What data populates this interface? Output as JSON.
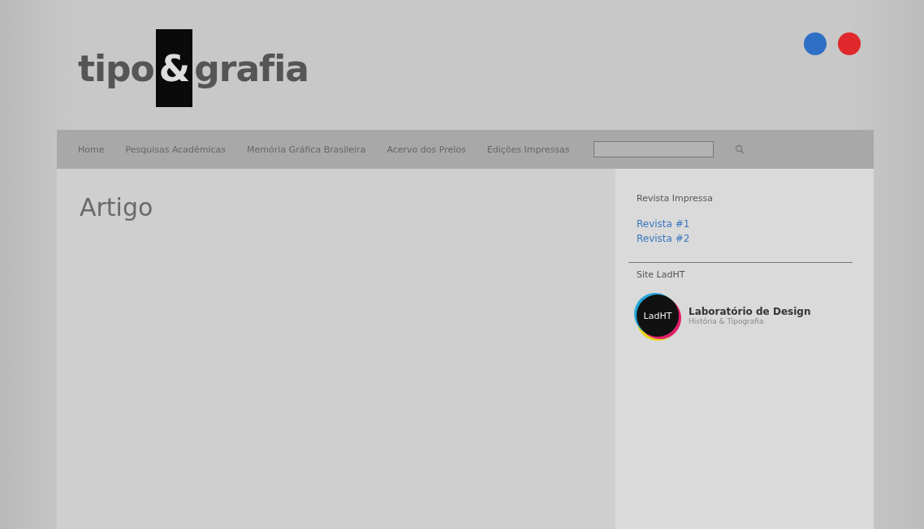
{
  "logo": {
    "before": "tipo",
    "mark": "&",
    "after": "grafia"
  },
  "social": [
    {
      "color": "#2d6fc4"
    },
    {
      "color": "#e0272b"
    }
  ],
  "nav": [
    {
      "label": "Home"
    },
    {
      "label": "Pesquisas Acadêmicas"
    },
    {
      "label": "Memória Gráfica Brasileira"
    },
    {
      "label": "Acervo dos Prelos"
    },
    {
      "label": "Edições Impressas"
    }
  ],
  "main": {
    "title": "Artigo"
  },
  "sidebar": {
    "sections": [
      {
        "title": "Revista Impressa",
        "links": [
          "Revista #1",
          "Revista #2"
        ]
      },
      {
        "title": "Site LadHT",
        "badge": {
          "logo_text": "LadHT",
          "name": "Laboratório de Design",
          "subtitle": "História & Tipografia"
        }
      }
    ]
  }
}
